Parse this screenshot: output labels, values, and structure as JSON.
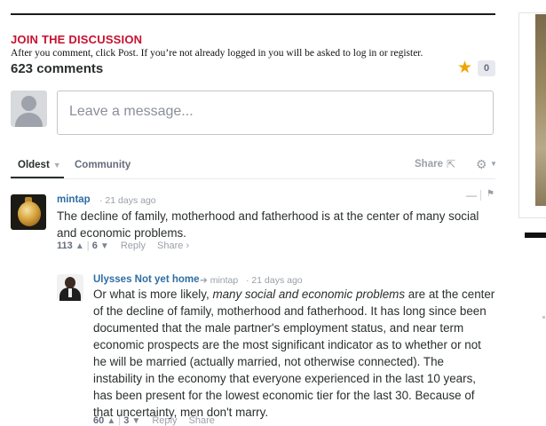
{
  "header": {
    "join_title": "JOIN THE DISCUSSION",
    "instructions": "After you comment, click Post. If you’re not already logged in you will be asked to log in or register.",
    "comment_count": "623 comments",
    "recommend_count": "0"
  },
  "composer": {
    "placeholder": "Leave a message..."
  },
  "tabs": {
    "sort_label": "Oldest",
    "community_label": "Community",
    "share_label": "Share"
  },
  "comments": [
    {
      "author": "mintap",
      "time": "· 21 days ago",
      "text": "The decline of family, motherhood and fatherhood is at the center of many social and economic problems.",
      "upvotes": "113",
      "downvotes": "6",
      "reply_label": "Reply",
      "share_label": "Share ›"
    },
    {
      "author": "Ulysses Not yet home",
      "reply_to": "➔ mintap",
      "time": "· 21 days ago",
      "text_before": "Or what is more likely, ",
      "text_em": "many social and economic problems",
      "text_after": " are at the center of the decline of family, motherhood and fatherhood. It has long since been documented that the male partner's employment status, and near term economic prospects are the most significant indicator as to whether or not he will be married (actually married, not otherwise connected). The instability in the economy that everyone experienced in the last 10 years, has been present for the lowest economic tier for the last 30. Because of that uncertainty, men don't marry.",
      "upvotes": "60",
      "downvotes": "3",
      "reply_label": "Reply",
      "share_label": "Share"
    }
  ],
  "icons": {
    "star": "star-icon",
    "share": "share-icon",
    "gear": "gear-icon",
    "flag": "flag-icon",
    "collapse": "collapse-icon"
  },
  "colors": {
    "join_title": "#c8102e",
    "author_link": "#2e6da4",
    "star": "#f0a500"
  }
}
